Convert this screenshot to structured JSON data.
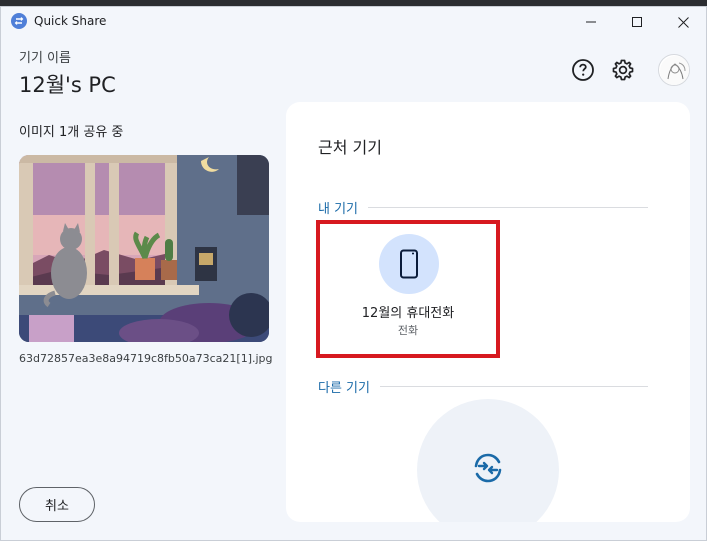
{
  "window": {
    "app_title": "Quick Share",
    "app_icon": "quick-share-icon",
    "controls": [
      "minimize-icon",
      "maximize-icon",
      "close-icon"
    ]
  },
  "header": {
    "device_caption": "기기 이름",
    "device_name": "12월's PC",
    "help_icon": "help-circle-icon",
    "settings_icon": "gear-icon",
    "avatar": "user-avatar"
  },
  "left": {
    "share_status": "이미지 1개 공유 중",
    "file_name": "63d72857ea3e8a94719c8fb50a73ca21[1].jpg",
    "cancel_label": "취소"
  },
  "card": {
    "title": "근처 기기",
    "my_devices_label": "내 기기",
    "other_devices_label": "다른 기기",
    "device": {
      "name": "12월의 휴대전화",
      "type": "전화",
      "icon": "phone-icon"
    },
    "scan_icon": "sync-arrows-icon"
  },
  "colors": {
    "accent": "#1a6aa8",
    "device_circle": "#d3e3fd",
    "highlight_border": "#d71920",
    "window_bg": "#f3f6fb",
    "card_bg": "#ffffff"
  }
}
